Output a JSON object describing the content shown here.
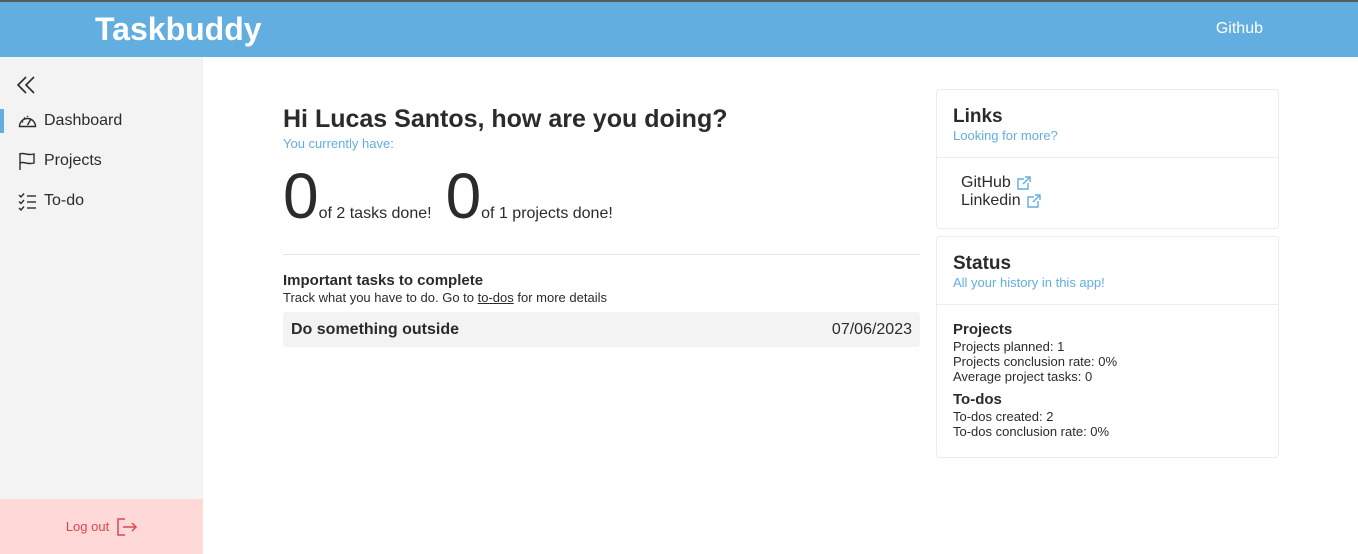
{
  "header": {
    "brand": "Taskbuddy",
    "github": "Github"
  },
  "sidebar": {
    "items": [
      {
        "label": "Dashboard",
        "icon": "gauge-icon",
        "active": true
      },
      {
        "label": "Projects",
        "icon": "flag-icon",
        "active": false
      },
      {
        "label": "To-do",
        "icon": "checklist-icon",
        "active": false
      }
    ],
    "logout": "Log out"
  },
  "main": {
    "greeting": "Hi Lucas Santos, how are you doing?",
    "currently": "You currently have:",
    "tasks_done": "0",
    "tasks_label": "of 2 tasks done!",
    "projects_done": "0",
    "projects_label": "of 1 projects done!",
    "important_title": "Important tasks to complete",
    "important_desc_pre": "Track what you have to do. Go to ",
    "important_desc_link": "to-dos",
    "important_desc_post": " for more details",
    "tasks": [
      {
        "title": "Do something outside",
        "date": "07/06/2023"
      }
    ]
  },
  "links_card": {
    "title": "Links",
    "subtitle": "Looking for more?",
    "links": [
      "GitHub",
      "Linkedin"
    ]
  },
  "status_card": {
    "title": "Status",
    "subtitle": "All your history in this app!",
    "projects_title": "Projects",
    "projects_lines": [
      "Projects planned: 1",
      "Projects conclusion rate: 0%",
      "Average project tasks: 0"
    ],
    "todos_title": "To-dos",
    "todos_lines": [
      "To-dos created: 2",
      "To-dos conclusion rate: 0%"
    ]
  },
  "colors": {
    "accent": "#62aee0",
    "logout_bg": "#ffd8d8",
    "logout_text": "#e0454d"
  }
}
